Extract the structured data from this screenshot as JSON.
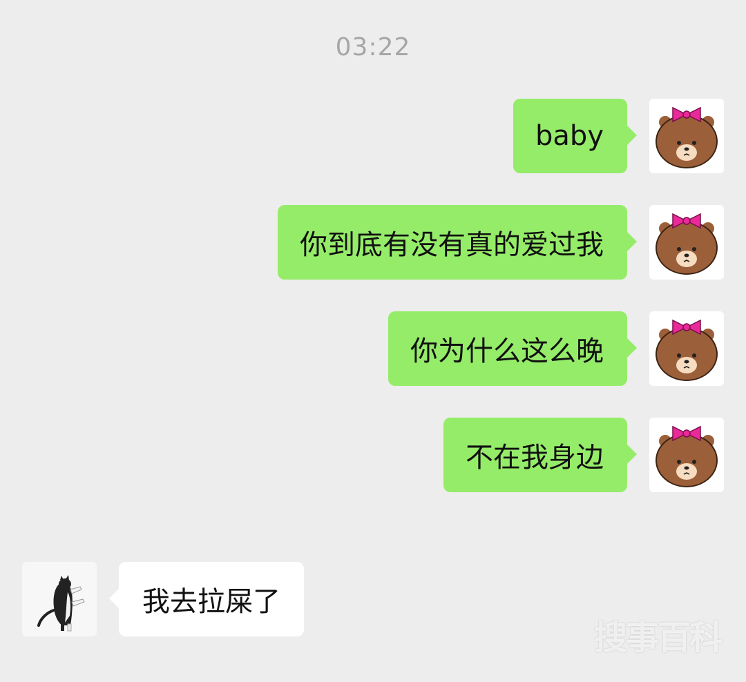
{
  "chat": {
    "timestamp": "03:22",
    "messages": [
      {
        "sender": "me",
        "text": "baby",
        "avatar": "brown-bear-with-pink-bow"
      },
      {
        "sender": "me",
        "text": "你到底有没有真的爱过我",
        "avatar": "brown-bear-with-pink-bow"
      },
      {
        "sender": "me",
        "text": "你为什么这么晚",
        "avatar": "brown-bear-with-pink-bow"
      },
      {
        "sender": "me",
        "text": "不在我身边",
        "avatar": "brown-bear-with-pink-bow"
      },
      {
        "sender": "other",
        "text": "我去拉屎了",
        "avatar": "black-white-cat"
      }
    ]
  },
  "watermark": "搜事百科",
  "colors": {
    "background": "#ededed",
    "sent_bubble": "#95ec69",
    "received_bubble": "#ffffff",
    "timestamp_text": "#a6a6a6"
  }
}
